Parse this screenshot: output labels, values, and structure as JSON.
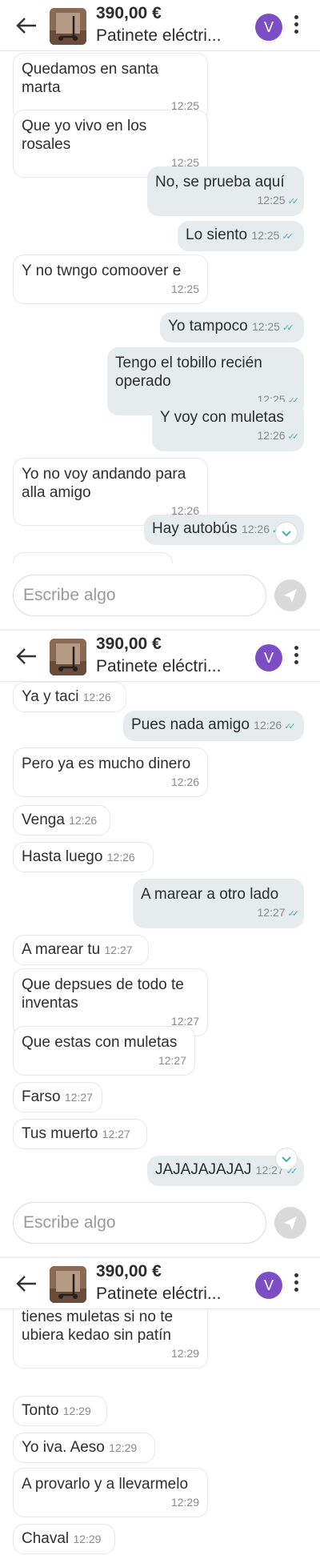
{
  "header": {
    "price": "390,00 €",
    "title": "Patinete eléctri...",
    "avatar_letter": "V"
  },
  "composer": {
    "placeholder": "Escribe algo"
  },
  "panel1": {
    "messages": [
      {
        "dir": "in",
        "text": "Quedamos en santa marta",
        "time": "12:25"
      },
      {
        "dir": "in",
        "text": "Que yo vivo en los rosales",
        "time": "12:25"
      },
      {
        "dir": "out",
        "text": "No, se prueba aquí",
        "time": "12:25"
      },
      {
        "dir": "out",
        "text": "Lo siento",
        "time": "12:25"
      },
      {
        "dir": "in",
        "text": "Y no twngo comoover e",
        "time": "12:25"
      },
      {
        "dir": "out",
        "text": "Yo tampoco",
        "time": "12:25"
      },
      {
        "dir": "out",
        "text": "Tengo el tobillo recién operado",
        "time": "12:25"
      },
      {
        "dir": "out",
        "text": "Y voy con muletas",
        "time": "12:26"
      },
      {
        "dir": "in",
        "text": "Yo no voy andando para alla amigo",
        "time": "12:26"
      },
      {
        "dir": "out",
        "text": "Hay autobús",
        "time": "12:26"
      }
    ]
  },
  "panel2": {
    "messages": [
      {
        "dir": "in",
        "text": "Ya y taci",
        "time": "12:26"
      },
      {
        "dir": "out",
        "text": "Pues nada amigo",
        "time": "12:26"
      },
      {
        "dir": "in",
        "text": "Pero ya es mucho dinero",
        "time": "12:26"
      },
      {
        "dir": "in",
        "text": "Venga",
        "time": "12:26"
      },
      {
        "dir": "in",
        "text": "Hasta luego",
        "time": "12:26"
      },
      {
        "dir": "out",
        "text": "A marear a otro lado",
        "time": "12:27"
      },
      {
        "dir": "in",
        "text": "A marear tu",
        "time": "12:27"
      },
      {
        "dir": "in",
        "text": "Que depsues de todo te inventas",
        "time": "12:27"
      },
      {
        "dir": "in",
        "text": "Que estas con muletas",
        "time": "12:27"
      },
      {
        "dir": "in",
        "text": "Farso",
        "time": "12:27"
      },
      {
        "dir": "in",
        "text": "Tus muerto",
        "time": "12:27"
      },
      {
        "dir": "out",
        "text": "JAJAJAJAJAJ",
        "time": "12:27"
      }
    ]
  },
  "panel3": {
    "messages": [
      {
        "dir": "in",
        "text": "Menos mal que estás que tienes muletas si no te ubiera kedao sin patín",
        "time": "12:29"
      },
      {
        "dir": "in",
        "text": "Tonto",
        "time": "12:29"
      },
      {
        "dir": "in",
        "text": "Yo iva. Aeso",
        "time": "12:29"
      },
      {
        "dir": "in",
        "text": "A provarlo y a llevarmelo",
        "time": "12:29"
      },
      {
        "dir": "in",
        "text": "Chaval",
        "time": "12:29"
      }
    ]
  },
  "icons": {
    "back": "arrow-left-icon",
    "more": "kebab-menu-icon",
    "send": "send-icon",
    "scroll": "chevron-down-icon"
  },
  "colors": {
    "avatar": "#7c4ec4",
    "read_tick": "#3fb5a6",
    "outgoing_bubble": "#e6ecee"
  }
}
